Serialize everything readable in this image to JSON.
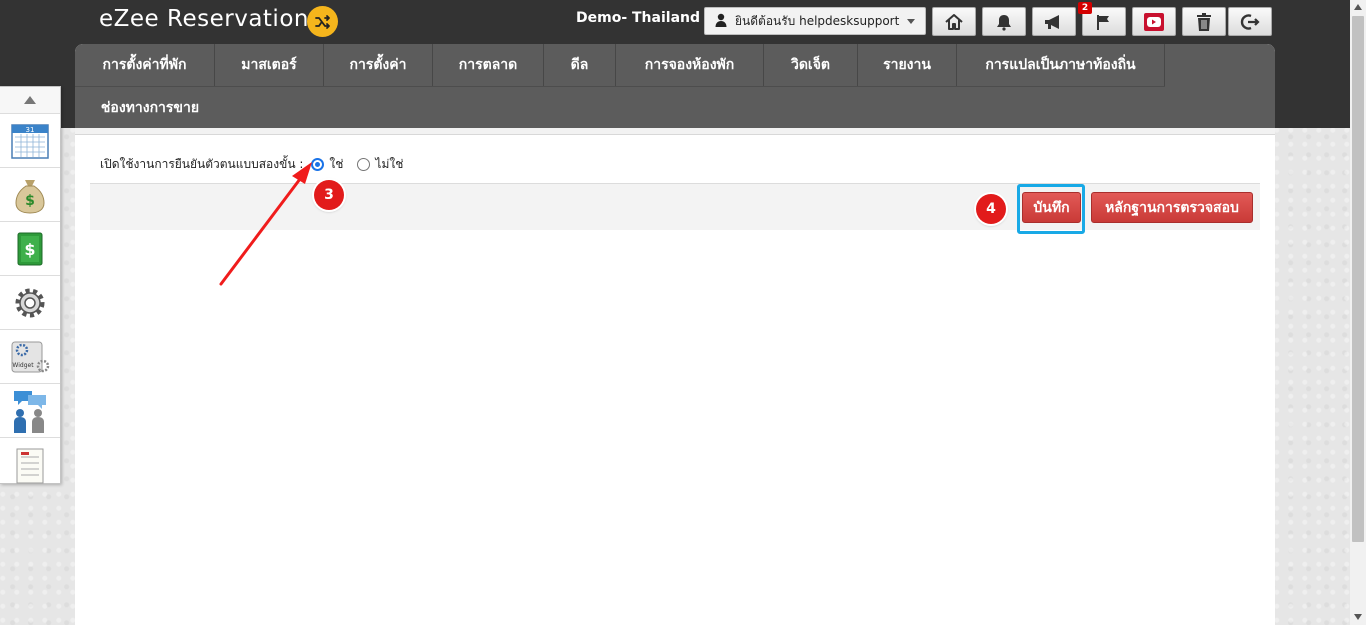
{
  "app": {
    "title": "eZee Reservation",
    "property": "Demo- Thailand"
  },
  "user_menu": {
    "label": "ยินดีต้อนรับ helpdesksupport"
  },
  "header_tools": [
    {
      "icon": "home-icon"
    },
    {
      "icon": "bell-icon"
    },
    {
      "icon": "megaphone-icon"
    },
    {
      "icon": "flag-icon",
      "badge": "2"
    },
    {
      "icon": "youtube-icon"
    },
    {
      "icon": "trash-icon"
    },
    {
      "icon": "logout-icon"
    }
  ],
  "nav": {
    "row1": [
      "การตั้งค่าที่พัก",
      "มาสเตอร์",
      "การตั้งค่า",
      "การตลาด",
      "ดีล",
      "การจองห้องพัก",
      "วิดเจ็ต",
      "รายงาน",
      "การแปลเป็นภาษาท้องถิ่น"
    ],
    "row2": [
      "ช่องทางการขาย"
    ]
  },
  "sidebar": [
    "calendar-icon",
    "money-bag-icon",
    "dollar-bill-icon",
    "settings-icon",
    "widget-icon",
    "users-chat-icon",
    "task-list-icon"
  ],
  "form": {
    "label": "เปิดใช้งานการยืนยันตัวตนแบบสองขั้น :",
    "options": [
      "ใช่",
      "ไม่ใช่"
    ],
    "selected": "ใช่"
  },
  "buttons": {
    "save": "บันทึก",
    "audit": "หลักฐานการตรวจสอบ"
  },
  "annotations": {
    "step3": "3",
    "step4": "4"
  },
  "colors": {
    "header": "#333333",
    "nav": "#5c5c5c",
    "accent_red": "#d2413e",
    "highlight": "#18a9e6",
    "step_marker": "#e21b1b"
  }
}
